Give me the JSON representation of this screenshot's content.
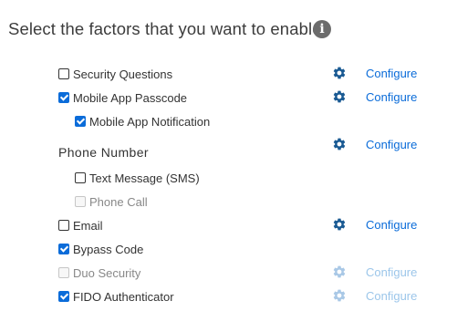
{
  "heading": "Select the factors that you want to enable:",
  "info_icon": "i",
  "colors": {
    "accent": "#0b6cd9",
    "gear_active": "#1a5a93",
    "gear_disabled": "#a9c8e6",
    "link_disabled": "#9cc6ea"
  },
  "factors": {
    "security_questions": {
      "label": "Security Questions",
      "checked": false,
      "configure": "Configure"
    },
    "mobile_app_passcode": {
      "label": "Mobile App Passcode",
      "checked": true,
      "configure": "Configure"
    },
    "mobile_app_notification": {
      "label": "Mobile App Notification",
      "checked": true
    },
    "phone_number": {
      "label": "Phone Number",
      "configure": "Configure"
    },
    "text_message": {
      "label": "Text Message (SMS)",
      "checked": false
    },
    "phone_call": {
      "label": "Phone Call",
      "checked": false,
      "disabled": true
    },
    "email": {
      "label": "Email",
      "checked": false,
      "configure": "Configure"
    },
    "bypass_code": {
      "label": "Bypass Code",
      "checked": true
    },
    "duo_security": {
      "label": "Duo Security",
      "checked": false,
      "disabled": true,
      "configure": "Configure"
    },
    "fido_authenticator": {
      "label": "FIDO Authenticator",
      "checked": true,
      "configure": "Configure",
      "configure_disabled": true
    }
  }
}
